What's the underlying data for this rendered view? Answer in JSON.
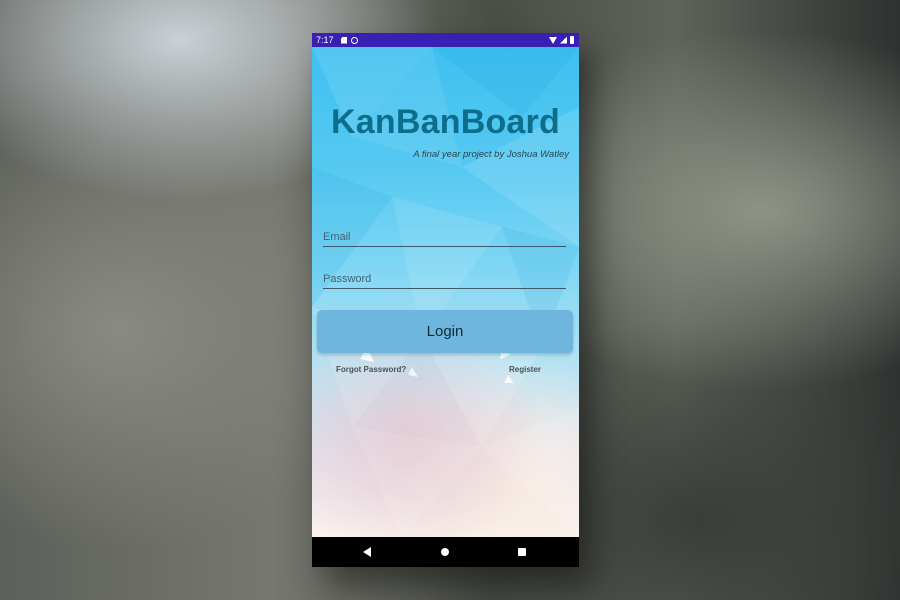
{
  "status_bar": {
    "time": "7:17",
    "left_icons": [
      "sd-card-icon",
      "sync-icon"
    ],
    "right_icons": [
      "wifi-icon",
      "signal-icon",
      "battery-icon"
    ],
    "color": "#3a1fb5"
  },
  "app": {
    "title": "KanBanBoard",
    "subtitle": "A final year project by Joshua Watley"
  },
  "login_form": {
    "email_placeholder": "Email",
    "email_value": "",
    "password_placeholder": "Password",
    "password_value": "",
    "login_label": "Login",
    "forgot_password_label": "Forgot Password?",
    "register_label": "Register"
  },
  "nav_bar": {
    "icons": [
      "back-icon",
      "home-icon",
      "recents-icon"
    ]
  },
  "colors": {
    "title": "#0d6e8c",
    "login_button": "#6fb6df",
    "background_top": "#3fc0f0",
    "background_bottom": "#fbf2ec"
  }
}
